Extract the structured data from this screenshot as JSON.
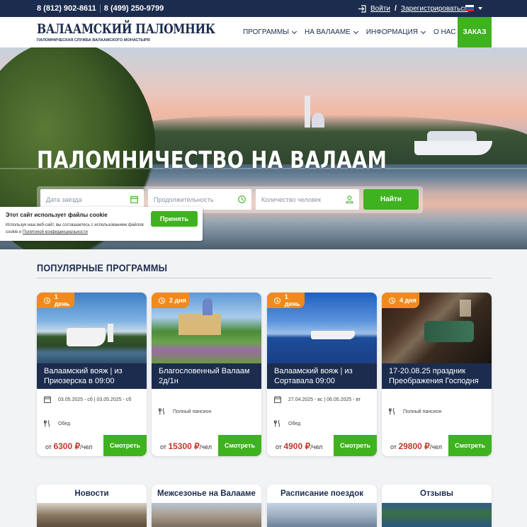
{
  "topbar": {
    "phone1": "8 (812) 902-8611",
    "phone2": "8 (499) 250-9799",
    "login": "Войти",
    "register": "Зарегистрироваться",
    "language_flag": "flag-ru-icon"
  },
  "header": {
    "logo_title": "ВАЛААМСКИЙ ПАЛОМНИК",
    "logo_subtitle": "ПАЛОМНИЧЕСКАЯ СЛУЖБА ВАЛААМСКОГО МОНАСТЫРЯ",
    "nav": [
      "ПРОГРАММЫ",
      "НА ВАЛААМЕ",
      "ИНФОРМАЦИЯ",
      "О НАС"
    ],
    "order": "ЗАКАЗ"
  },
  "hero": {
    "title": "ПАЛОМНИЧЕСТВО НА ВАЛААМ",
    "date_placeholder": "Дата заезда",
    "duration_placeholder": "Продолжительность",
    "people_placeholder": "Количество человек",
    "search_button": "Найти"
  },
  "cookie": {
    "title": "Этот сайт использует файлы cookie",
    "text": "Используя наш веб-сайт, вы соглашаетесь с использованием файлов cookie и",
    "link": "Политикой конфиденциальности",
    "accept": "Принять"
  },
  "popular": {
    "title": "ПОПУЛЯРНЫЕ ПРОГРАММЫ",
    "cards": [
      {
        "badge": "1 день",
        "title": "Валаамский вояж | из Приозерска в 09:00",
        "dates": "03.05.2025 - сб | 03.05.2025 - сб",
        "meal": "Обед",
        "price_prefix": "от",
        "price": "6300 ₽",
        "price_suffix": "/чел",
        "button": "Смотреть"
      },
      {
        "badge": "2 дня",
        "title": "Благословенный Валаам 2д/1н",
        "meal": "Полный пансион",
        "price_prefix": "от",
        "price": "15300 ₽",
        "price_suffix": "/чел",
        "button": "Смотреть"
      },
      {
        "badge": "1 день",
        "title": "Валаамский вояж | из Сортавала 09:00",
        "dates": "27.04.2025 - вс | 06.05.2025 - вт",
        "meal": "Обед",
        "price_prefix": "от",
        "price": "4900 ₽",
        "price_suffix": "/чел",
        "button": "Смотреть"
      },
      {
        "badge": "4 дня",
        "title": "17-20.08.25 праздник Преображения Господня",
        "meal": "Полный пансион",
        "price_prefix": "от",
        "price": "29800 ₽",
        "price_suffix": "/чел",
        "button": "Смотреть"
      }
    ]
  },
  "tiles": [
    "Новости",
    "Межсезонье на Валааме",
    "Расписание поездок",
    "Отзывы"
  ],
  "colors": {
    "navy": "#1c2c4e",
    "green": "#3fb21f",
    "orange": "#f08a1c",
    "price_red": "#c0392b"
  }
}
